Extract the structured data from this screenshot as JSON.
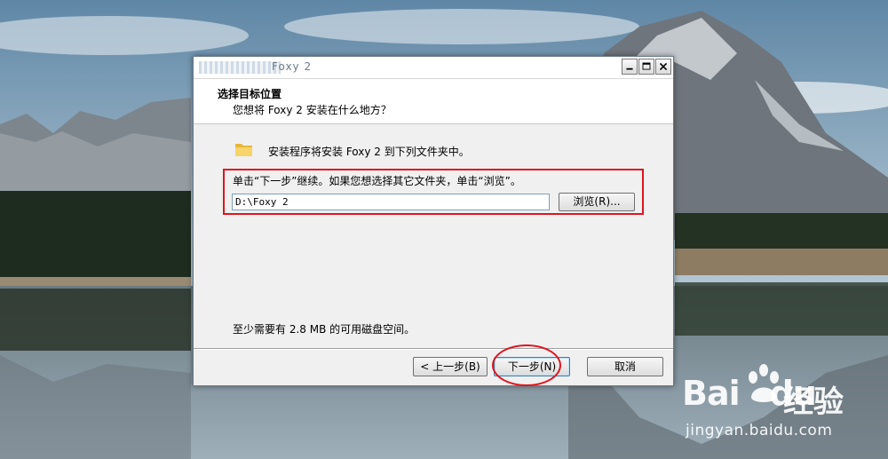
{
  "window": {
    "title": "Foxy 2",
    "minimize_label": "minimize",
    "maximize_label": "maximize",
    "close_label": "close"
  },
  "header": {
    "title": "选择目标位置",
    "subtitle": "您想将 Foxy 2 安装在什么地方？"
  },
  "body": {
    "install_line": "安装程序将安装 Foxy 2 到下列文件夹中。",
    "instruction": "单击“下一步”继续。如果您想选择其它文件夹，单击“浏览”。",
    "path_value": "D:\\Foxy 2",
    "browse_label": "浏览(R)...",
    "disk_space": "至少需要有 2.8 MB 的可用磁盘空间。"
  },
  "buttons": {
    "back": "< 上一步(B)",
    "next": "下一步(N)",
    "cancel": "取消"
  },
  "watermark": {
    "logo": "Bai",
    "logo_suffix": "du",
    "cn": "经验",
    "url": "jingyan.baidu.com"
  },
  "colors": {
    "annotation_red": "#e0141e",
    "folder_yellow": "#f3c64a"
  }
}
